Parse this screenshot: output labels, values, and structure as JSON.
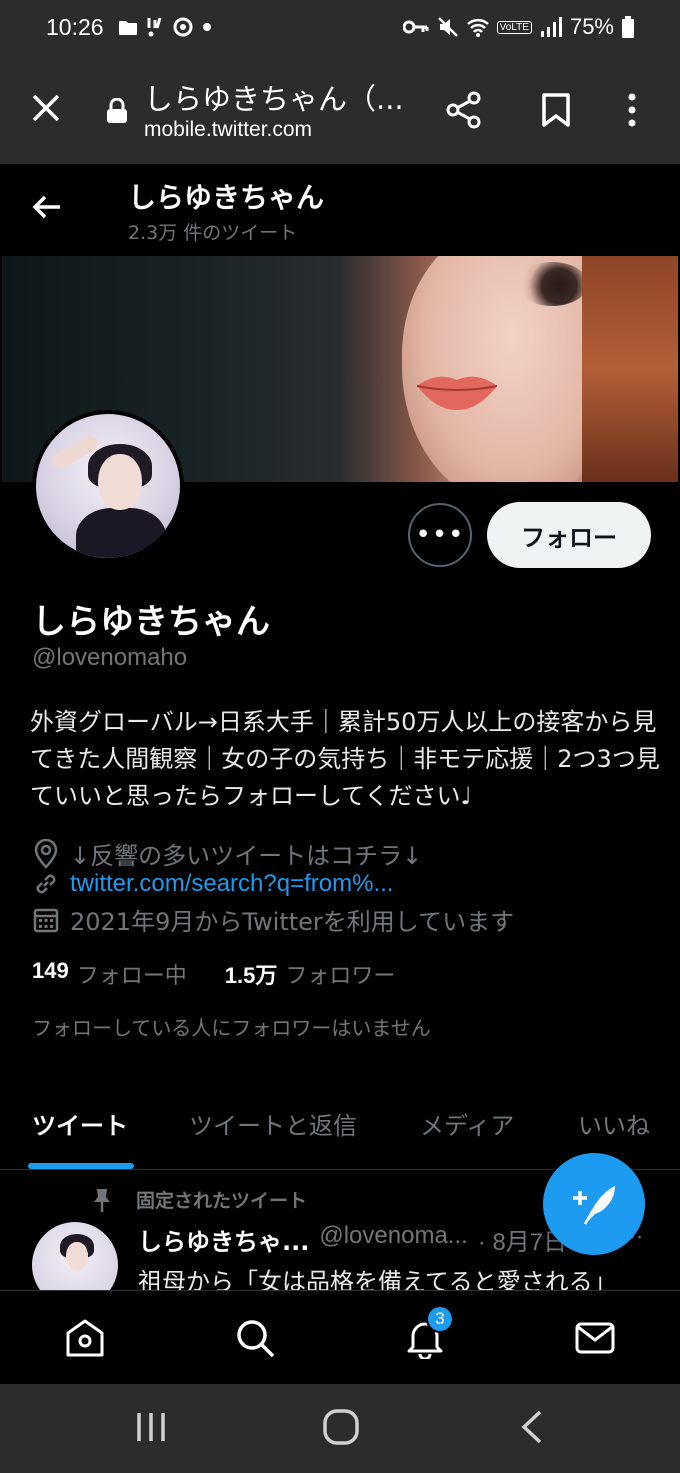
{
  "status_bar": {
    "time": "10:26",
    "battery": "75%",
    "network": "VoLTE"
  },
  "browser": {
    "title": "しらゆきちゃん（...",
    "url": "mobile.twitter.com"
  },
  "header": {
    "name": "しらゆきちゃん",
    "tweet_count": "2.3万 件のツイート"
  },
  "profile": {
    "follow_label": "フォロー",
    "more_label": "•••",
    "name": "しらゆきちゃん",
    "handle": "@lovenomaho",
    "bio": "外資グローバル→日系大手｜累計50万人以上の接客から見てきた人間観察｜女の子の気持ち｜非モテ応援｜2つ3つ見ていいと思ったらフォローしてください♩",
    "location": "↓反響の多いツイートはコチラ↓",
    "link": "twitter.com/search?q=from%...",
    "joined": "2021年9月からTwitterを利用しています",
    "following_count": "149",
    "following_label": "フォロー中",
    "followers_count": "1.5万",
    "followers_label": "フォロワー",
    "no_mutual": "フォローしている人にフォロワーはいません"
  },
  "tabs": [
    {
      "label": "ツイート"
    },
    {
      "label": "ツイートと返信"
    },
    {
      "label": "メディア"
    },
    {
      "label": "いいね"
    }
  ],
  "pinned_tweet": {
    "pinned_label": "固定されたツイート",
    "name": "しらゆきちゃ...",
    "handle": "@lovenoma...",
    "date": "· 8月7日",
    "more": "···",
    "text": "祖母から「女は品格を備えてると愛される」"
  },
  "bottom_nav": {
    "notification_badge": "3"
  },
  "colors": {
    "accent": "#1d9bf0",
    "background": "#000000",
    "muted": "#71767b",
    "chrome": "#2b2c2e"
  },
  "icons": {
    "status_left": [
      "folder-icon",
      "signal-boost-icon",
      "sync-icon",
      "dot-icon"
    ],
    "status_right": [
      "key-icon",
      "mute-icon",
      "wifi-icon",
      "signal-icon",
      "battery-icon"
    ],
    "bottom_nav": [
      "home-icon",
      "search-icon",
      "bell-icon",
      "mail-icon"
    ],
    "android_nav": [
      "recents-icon",
      "home-circle-icon",
      "back-chevron-icon"
    ]
  }
}
